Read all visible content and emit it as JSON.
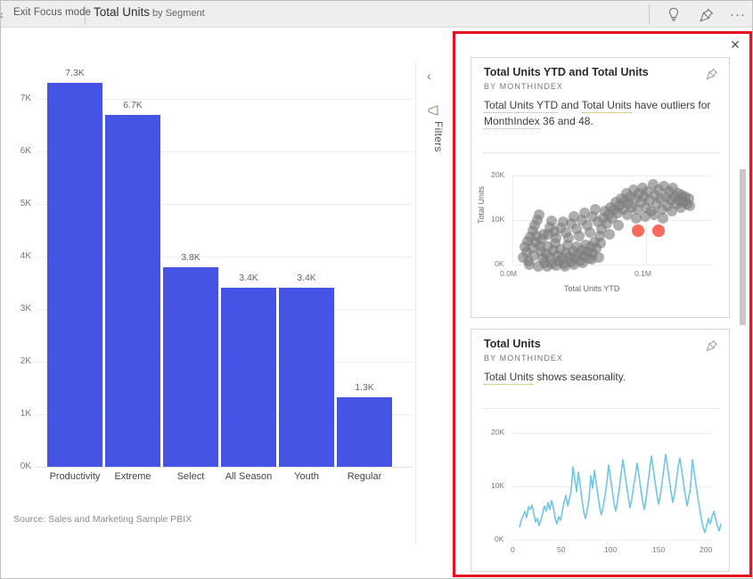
{
  "header": {
    "back_chevron": "‹",
    "exit_focus_label": "Exit Focus mode",
    "visual_title": "Total Units",
    "visual_subtitle": "by Segment",
    "icons": {
      "insights": "lightbulb-icon",
      "pin": "pin-icon",
      "more": "···"
    }
  },
  "filters_pane": {
    "label": "Filters",
    "expand_chevron": "‹",
    "icon": "filter-icon"
  },
  "main_visual": {
    "source_note": "Source: Sales and Marketing Sample PBIX",
    "bar_color": "#4554e4"
  },
  "insights_panel": {
    "close_label": "✕",
    "border_color": "#e81123",
    "cards": [
      {
        "title": "Total Units YTD and Total Units",
        "subtitle": "BY MONTHINDEX",
        "pin_icon": "pin-icon",
        "body_parts": [
          {
            "text": "Total Units YTD",
            "underline": true
          },
          {
            "text": " and ",
            "underline": false
          },
          {
            "text": "Total Units",
            "underline": true
          },
          {
            "text": " have outliers for ",
            "underline": false
          },
          {
            "text": "MonthIndex",
            "underline": true
          },
          {
            "text": " 36 and 48.",
            "underline": false
          }
        ]
      },
      {
        "title": "Total Units",
        "subtitle": "BY MONTHINDEX",
        "pin_icon": "pin-icon",
        "body_parts": [
          {
            "text": "Total Units",
            "underline": true
          },
          {
            "text": " shows seasonality.",
            "underline": false
          }
        ]
      }
    ]
  },
  "chart_data": [
    {
      "type": "bar",
      "title": "Total Units by Segment",
      "categories": [
        "Productivity",
        "Extreme",
        "Select",
        "All Season",
        "Youth",
        "Regular"
      ],
      "values": [
        7300,
        6700,
        3800,
        3400,
        3400,
        1300
      ],
      "data_labels": [
        "7.3K",
        "6.7K",
        "3.8K",
        "3.4K",
        "3.4K",
        "1.3K"
      ],
      "xlabel": "",
      "ylabel": "",
      "ytick_labels": [
        "0K",
        "1K",
        "2K",
        "3K",
        "4K",
        "5K",
        "6K",
        "7K"
      ],
      "ytick_values": [
        0,
        1000,
        2000,
        3000,
        4000,
        5000,
        6000,
        7000
      ],
      "ylim": [
        0,
        7600
      ],
      "grid": true,
      "legend": "none"
    },
    {
      "type": "scatter",
      "title": "Total Units YTD and Total Units",
      "subtitle": "BY MONTHINDEX",
      "xlabel": "Total Units YTD",
      "ylabel": "Total Units",
      "xtick_labels": [
        "0.0M",
        "0.1M"
      ],
      "xtick_values": [
        0,
        100000
      ],
      "ytick_labels": [
        "0K",
        "10K",
        "20K"
      ],
      "ytick_values": [
        0,
        10000,
        20000
      ],
      "xlim": [
        0,
        140000
      ],
      "ylim": [
        0,
        21000
      ],
      "grid": true,
      "series": [
        {
          "name": "normal",
          "color": "#7d7d7d",
          "point_count": 190
        },
        {
          "name": "outliers",
          "color": "#fa6a5a",
          "points": [
            [
              80000,
              9200
            ],
            [
              95000,
              9200
            ]
          ]
        }
      ]
    },
    {
      "type": "line",
      "title": "Total Units",
      "subtitle": "BY MONTHINDEX",
      "xlabel": "",
      "ylabel": "",
      "xtick_labels": [
        "0",
        "50",
        "100",
        "150",
        "200"
      ],
      "xtick_values": [
        0,
        50,
        100,
        150,
        200
      ],
      "ytick_labels": [
        "0K",
        "10K",
        "20K"
      ],
      "ytick_values": [
        0,
        10000,
        20000
      ],
      "xlim": [
        0,
        200
      ],
      "ylim": [
        0,
        21000
      ],
      "grid": true,
      "line_color": "#6fc6e5",
      "series": [
        {
          "name": "Total Units",
          "description": "seasonal oscillation rising to ~15K near index 95-120 then dropping to ~3-7K band"
        }
      ]
    }
  ]
}
